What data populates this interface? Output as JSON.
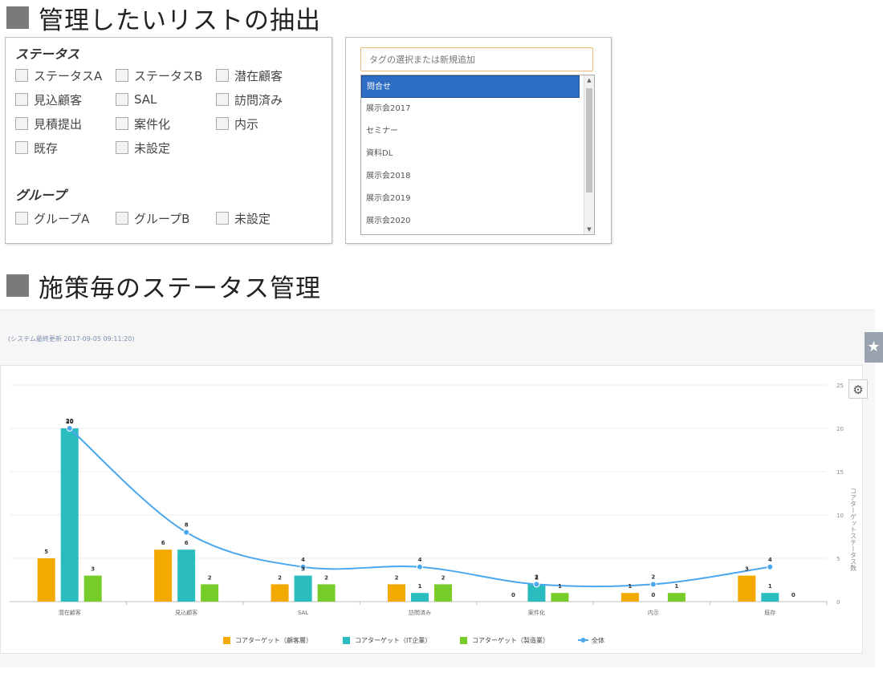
{
  "sections": {
    "list_title": "管理したいリストの抽出",
    "status_title": "施策毎のステータス管理"
  },
  "filters": {
    "status_label": "ステータス",
    "status_items": [
      "ステータスA",
      "ステータスB",
      "潜在顧客",
      "見込顧客",
      "SAL",
      "訪問済み",
      "見積提出",
      "案件化",
      "内示",
      "既存",
      "未設定"
    ],
    "group_label": "グループ",
    "group_items": [
      "グループA",
      "グループB",
      "未設定"
    ]
  },
  "tags": {
    "placeholder": "タグの選択または新規追加",
    "options": [
      "問合せ",
      "展示会2017",
      "セミナー",
      "資料DL",
      "展示会2018",
      "展示会2019",
      "展示会2020"
    ],
    "selected_index": 0
  },
  "report": {
    "updated_text": "(システム最終更新 2017-09-05 09:11:20)"
  },
  "colors": {
    "series1": "#f4a900",
    "series2": "#2bbcbf",
    "series3": "#77cc2a",
    "line": "#4aa7ee",
    "selected": "#2d6ec4",
    "input_border": "#f2b97a"
  },
  "chart_data": {
    "type": "bar",
    "categories": [
      "潜在顧客",
      "見込顧客",
      "SAL",
      "訪問済み",
      "案件化",
      "内示",
      "既存"
    ],
    "series": [
      {
        "name": "コアターゲット（顧客層）",
        "type": "bar",
        "values": [
          5,
          6,
          2,
          2,
          0,
          1,
          3
        ]
      },
      {
        "name": "コアターゲット（IT企業）",
        "type": "bar",
        "values": [
          20,
          6,
          3,
          1,
          2,
          0,
          1
        ]
      },
      {
        "name": "コアターゲット（製造業）",
        "type": "bar",
        "values": [
          3,
          2,
          2,
          2,
          1,
          1,
          0
        ]
      },
      {
        "name": "全体",
        "type": "line",
        "values": [
          20,
          8,
          4,
          4,
          2,
          2,
          4
        ]
      }
    ],
    "ylim": [
      0,
      25
    ],
    "yticks": [
      0,
      5,
      10,
      15,
      20,
      25
    ],
    "ylabel_right": "コアターゲットステータス数",
    "grid": true,
    "legend_position": "bottom"
  }
}
